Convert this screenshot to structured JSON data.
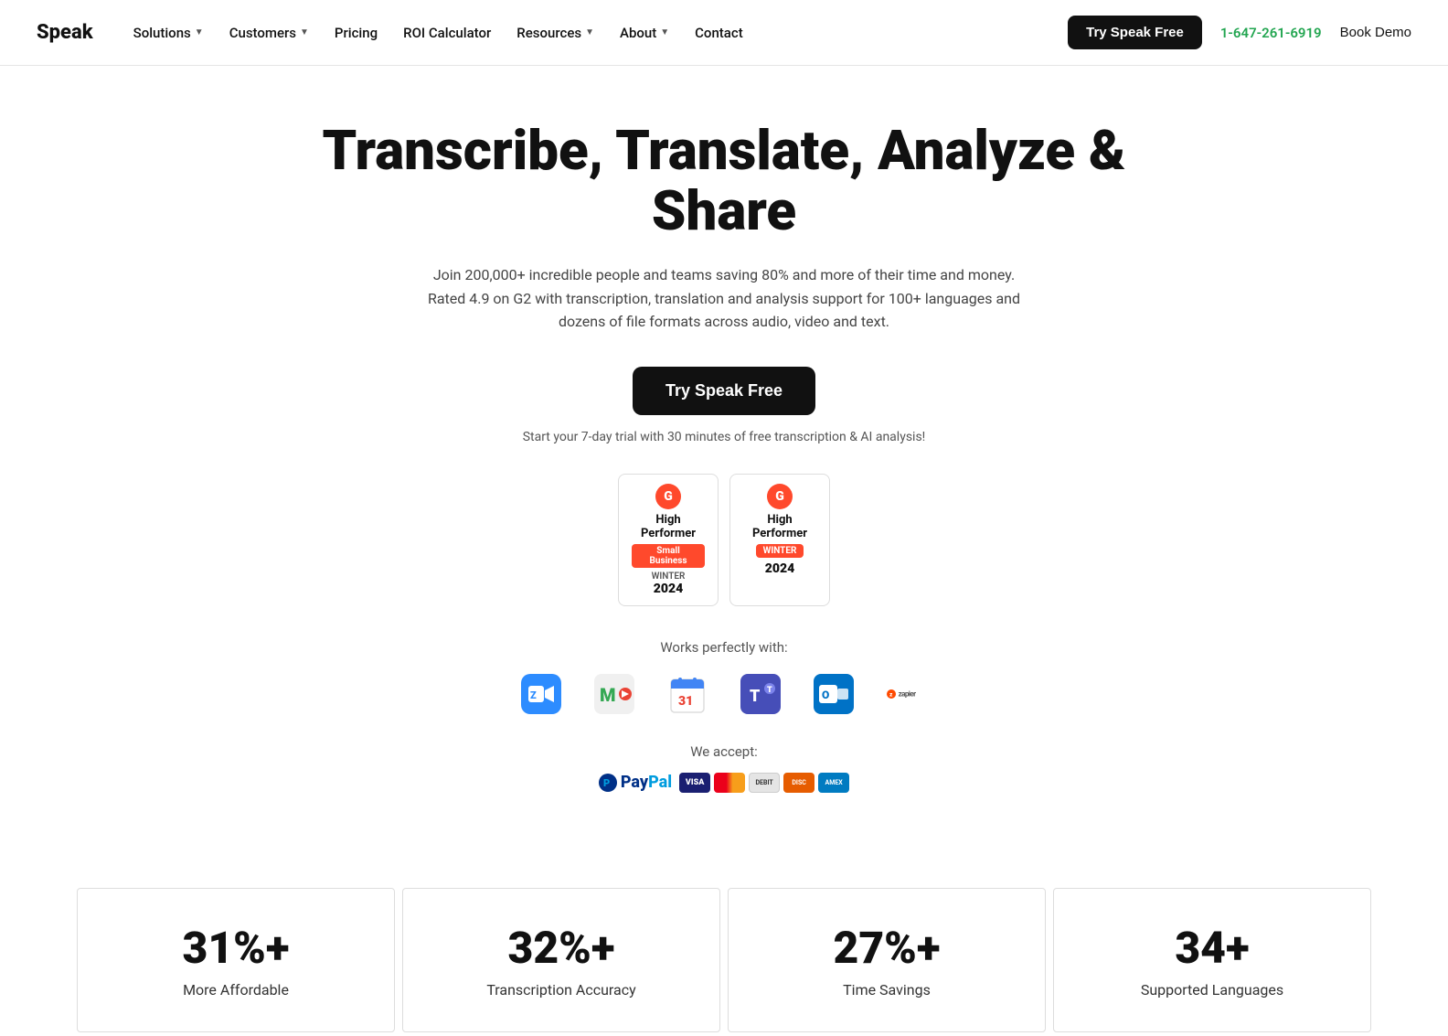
{
  "brand": {
    "name": "Speak"
  },
  "navbar": {
    "solutions_label": "Solutions",
    "customers_label": "Customers",
    "pricing_label": "Pricing",
    "roi_calculator_label": "ROI Calculator",
    "resources_label": "Resources",
    "about_label": "About",
    "contact_label": "Contact",
    "try_free_label": "Try Speak Free",
    "phone": "1-647-261-6919",
    "book_demo_label": "Book Demo"
  },
  "hero": {
    "title": "Transcribe, Translate, Analyze & Share",
    "subtitle": "Join 200,000+ incredible people and teams saving 80% and more of their time and money. Rated 4.9 on G2 with transcription, translation and analysis support for 100+ languages and dozens of file formats across audio, video and text.",
    "cta_label": "Try Speak Free",
    "trial_text": "Start your 7-day trial with 30 minutes of free transcription & AI analysis!"
  },
  "badges": [
    {
      "g2_letter": "G",
      "title": "High Performer",
      "sub": "Small Business",
      "season": "WINTER",
      "year": "2024"
    },
    {
      "g2_letter": "G",
      "title": "High Performer",
      "sub": "WINTER",
      "season": "",
      "year": "2024"
    }
  ],
  "integrations": {
    "label": "Works perfectly with:",
    "items": [
      {
        "name": "Zoom",
        "symbol": "Z"
      },
      {
        "name": "Google Meet",
        "symbol": "M"
      },
      {
        "name": "Google Calendar",
        "symbol": "31"
      },
      {
        "name": "Microsoft Teams",
        "symbol": "T"
      },
      {
        "name": "Outlook",
        "symbol": "O"
      },
      {
        "name": "Zapier",
        "symbol": "zapier"
      }
    ]
  },
  "payment": {
    "label": "We accept:",
    "paypal_text": "PayPal",
    "cards": [
      "VISA",
      "MC",
      "MC2",
      "Discover",
      "Amex"
    ]
  },
  "stats": [
    {
      "number": "31%+",
      "label": "More Affordable"
    },
    {
      "number": "32%+",
      "label": "Transcription Accuracy"
    },
    {
      "number": "27%+",
      "label": "Time Savings"
    },
    {
      "number": "34+",
      "label": "Supported Languages"
    }
  ]
}
